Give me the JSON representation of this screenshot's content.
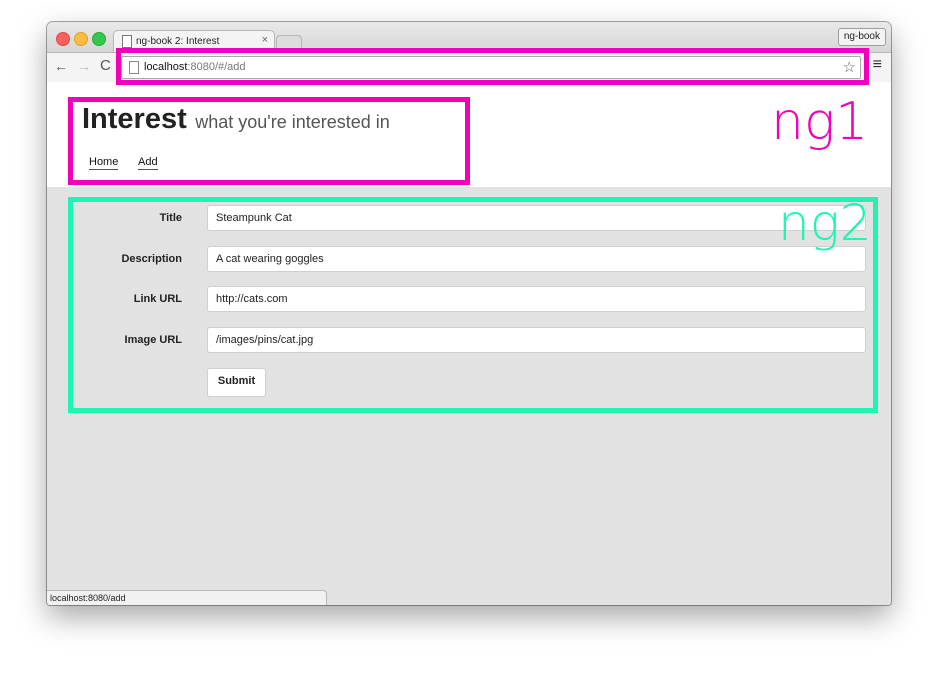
{
  "browser": {
    "tab_title": "ng-book 2: Interest",
    "tab_close": "×",
    "profile_label": "ng-book",
    "nav_back": "←",
    "nav_forward": "→",
    "nav_reload": "C",
    "url_host": "localhost",
    "url_rest": ":8080/#/add",
    "star_glyph": "☆",
    "menu_glyph": "≡",
    "status_text": "localhost:8080/add"
  },
  "header": {
    "title": "Interest",
    "subtitle": "what you're interested in",
    "nav": [
      {
        "label": "Home"
      },
      {
        "label": "Add"
      }
    ]
  },
  "form": {
    "fields": [
      {
        "label": "Title",
        "value": "Steampunk Cat"
      },
      {
        "label": "Description",
        "value": "A cat wearing goggles"
      },
      {
        "label": "Link URL",
        "value": "http://cats.com"
      },
      {
        "label": "Image URL",
        "value": "/images/pins/cat.jpg"
      }
    ],
    "submit_label": "Submit"
  },
  "annotations": {
    "ng1_label": "ng1",
    "ng2_label": "ng2",
    "ng1_color": "#f000b8",
    "ng2_color": "#1ef5b3"
  }
}
